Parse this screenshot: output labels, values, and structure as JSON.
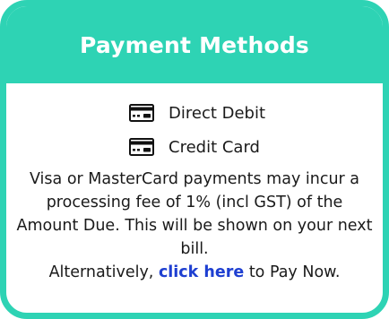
{
  "header": {
    "title": "Payment Methods"
  },
  "methods": [
    {
      "label": "Direct Debit",
      "icon": "credit-card-icon"
    },
    {
      "label": "Credit Card",
      "icon": "credit-card-icon"
    }
  ],
  "note": {
    "fee_text": "Visa or MasterCard payments may incur a processing fee of 1% (incl GST) of the Amount Due. This will be shown on your next bill.",
    "alt_prefix": "Alternatively, ",
    "link_text": "click here",
    "alt_suffix": " to Pay Now."
  },
  "colors": {
    "accent": "#2ed3b4",
    "link": "#1e3fd1"
  }
}
